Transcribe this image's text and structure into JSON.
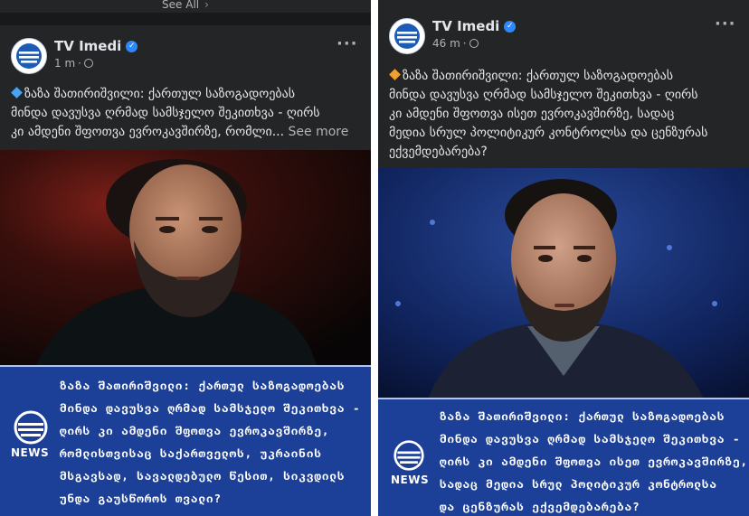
{
  "left_post": {
    "see_all": "See All",
    "page_name": "TV Imedi",
    "time": "1 m",
    "caption_lines": [
      "ზაზა შათირიშვილი: ქართულ საზოგადოებას",
      "მინდა დავუსვა ღრმად სამსჯელო შეკითხვა  - ღირს",
      "კი ამდენი შფოთვა ევროკავშირზე, რომლი..."
    ],
    "see_more": "See more",
    "news_label": "NEWS",
    "headline_lines": [
      "ზაზა შათირიშვილი: ქართულ საზოგადოებას",
      "მინდა დავუსვა ღრმად სამსჯელო შეკითხვა -",
      "ღირს კი ამდენი შფოთვა ევროკავშირზე,",
      "რომლისთვისაც საქართველოს, უკრაინის",
      "მსგავსად, სავალდებულო წესით, სიკვდილს",
      "უნდა გაუსწოროს თვალი?"
    ]
  },
  "right_post": {
    "page_name": "TV Imedi",
    "time": "46 m",
    "caption_lines": [
      "ზაზა შათირიშვილი: ქართულ საზოგადოებას",
      "მინდა დავუსვა ღრმად სამსჯელო შეკითხვა - ღირს",
      "კი ამდენი შფოთვა ისეთ ევროკავშირზე, სადაც",
      "მედია სრულ პოლიტიკურ კონტროლსა და ცენზურას",
      "ექვემდებარება?"
    ],
    "news_label": "NEWS",
    "headline_lines": [
      "ზაზა შათირიშვილი: ქართულ საზოგადოებას",
      "მინდა დავუსვა ღრმად სამსჯელო შეკითხვა -",
      "ღირს კი ამდენი შფოთვა ისეთ ევროკავშირზე,",
      "სადაც მედია სრულ პოლიტიკურ კონტროლსა",
      "და ცენზურას ექვემდებარება?"
    ]
  },
  "icons": {
    "verified": "verified-badge-icon",
    "globe": "public-audience-globe-icon",
    "more": "more-options-icon",
    "logo": "imedi-logo-icon"
  },
  "colors": {
    "card_bg": "#242526",
    "text_primary": "#e4e6eb",
    "text_secondary": "#b0b3b8",
    "verified_blue": "#2d88ff",
    "news_banner": "#1c3f98",
    "marker_left": "#4aa3f0",
    "marker_right": "#f0a030"
  }
}
